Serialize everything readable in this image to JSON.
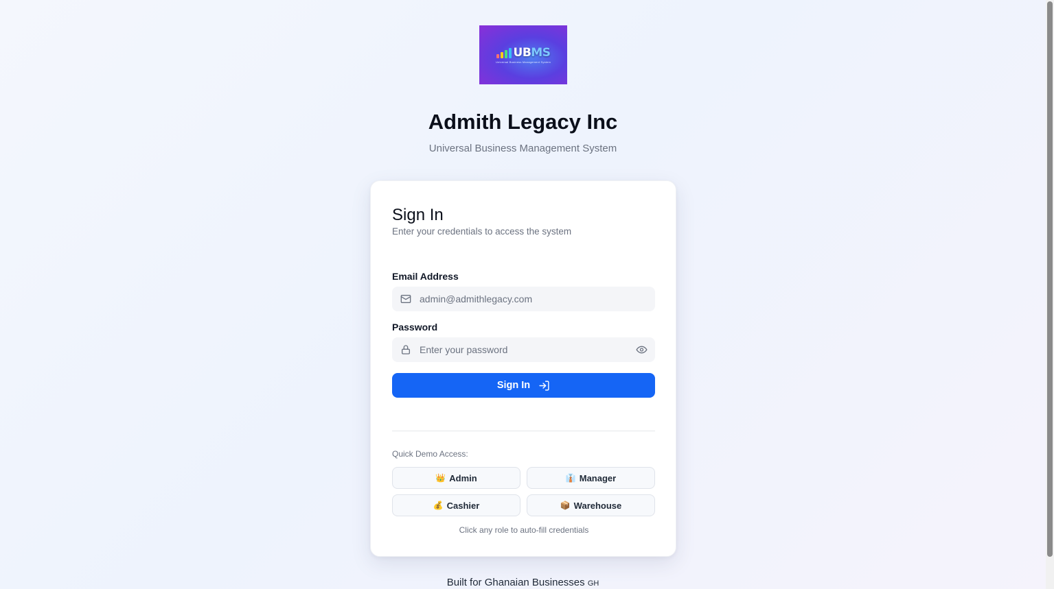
{
  "brand": {
    "logo_text_a": "UB",
    "logo_text_b": "MS",
    "logo_tagline": "Universal Business Management System",
    "company_name": "Admith Legacy Inc",
    "subtitle": "Universal Business Management System"
  },
  "signin": {
    "title": "Sign In",
    "subtitle": "Enter your credentials to access the system",
    "email_label": "Email Address",
    "email_placeholder": "admin@admithlegacy.com",
    "password_label": "Password",
    "password_placeholder": "Enter your password",
    "submit_label": "Sign In"
  },
  "demo": {
    "label": "Quick Demo Access:",
    "roles": [
      {
        "emoji": "👑",
        "label": "Admin"
      },
      {
        "emoji": "👔",
        "label": "Manager"
      },
      {
        "emoji": "💰",
        "label": "Cashier"
      },
      {
        "emoji": "📦",
        "label": "Warehouse"
      }
    ],
    "hint": "Click any role to auto-fill credentials"
  },
  "footer": {
    "text": "Built for Ghanaian Businesses",
    "flag": "GH"
  },
  "colors": {
    "primary": "#1565f5",
    "background": "#f4f7fd"
  },
  "icons": {
    "email": "mail-icon",
    "password": "lock-icon",
    "toggle": "eye-icon",
    "submit": "login-arrow-icon"
  }
}
